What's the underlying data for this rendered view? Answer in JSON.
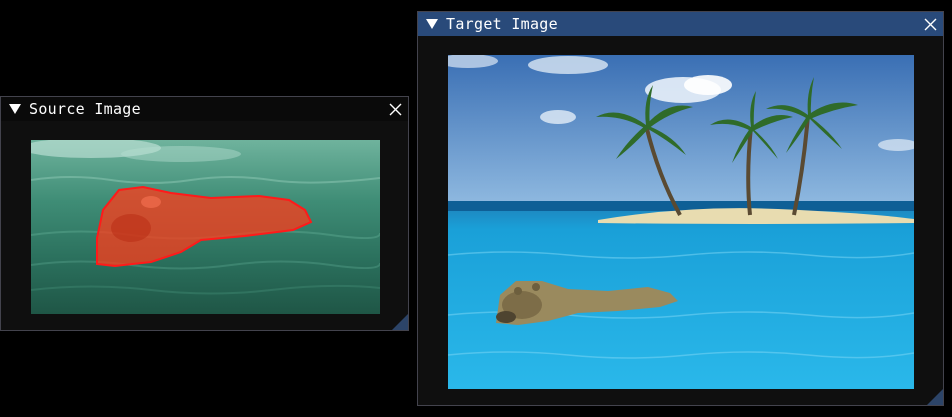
{
  "source_window": {
    "title": "Source Image",
    "image_icon": "swimming-bear-photo-with-red-selection-mask",
    "collapse_icon": "triangle-down-icon",
    "close_icon": "close-x-icon"
  },
  "target_window": {
    "title": "Target Image",
    "image_icon": "tropical-island-pool-with-bear-photo",
    "collapse_icon": "triangle-down-icon",
    "close_icon": "close-x-icon"
  },
  "colors": {
    "title_active": "#294a7a",
    "title_inactive": "#0a0a0a",
    "window_bg": "#0f0f0f",
    "border": "#43434d",
    "mask": "#ff3b1a",
    "mask_outline": "#ff1a1a"
  }
}
